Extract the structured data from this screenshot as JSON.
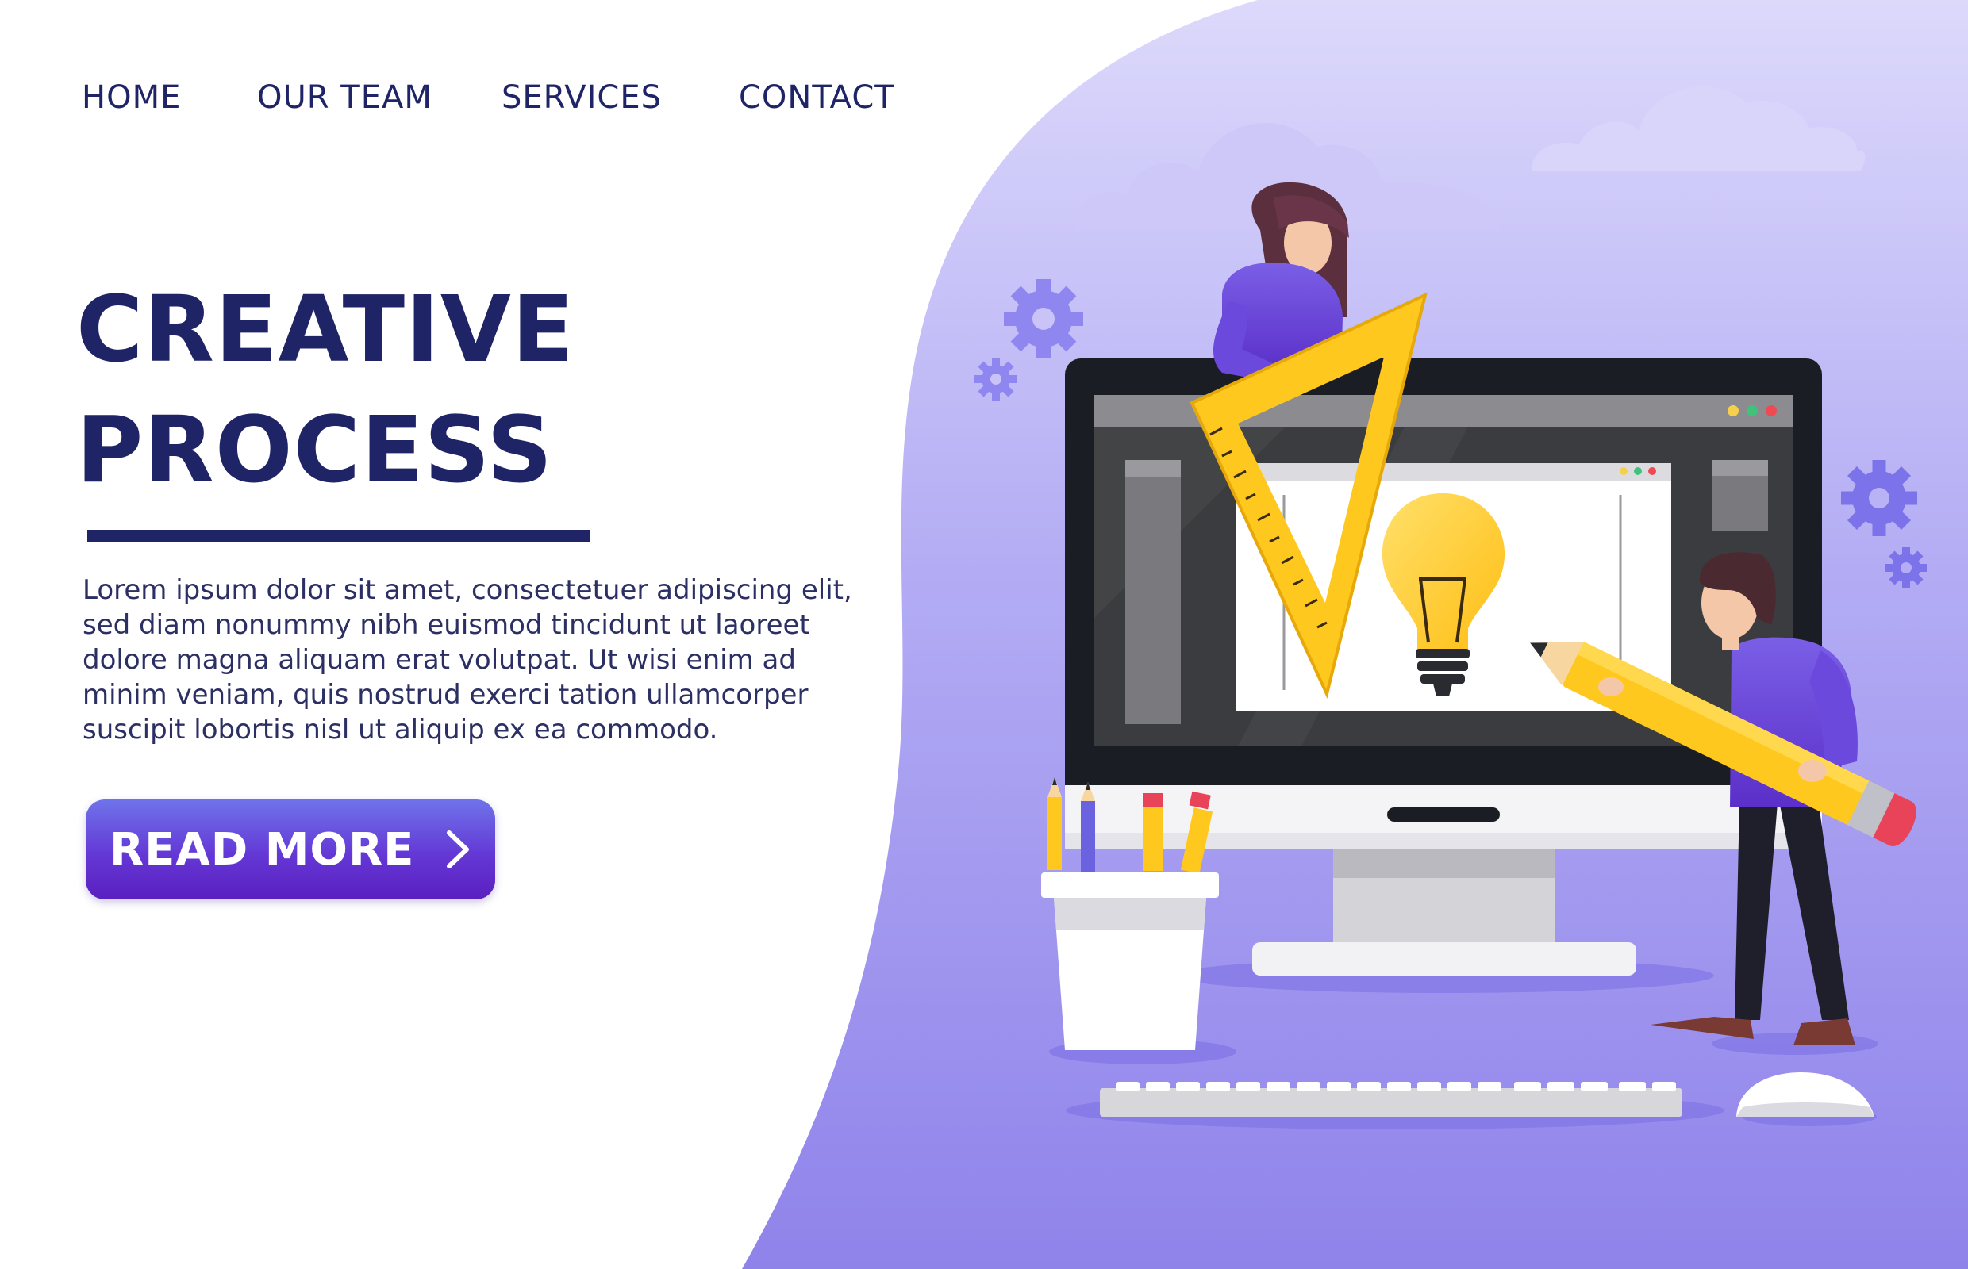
{
  "nav": {
    "items": [
      {
        "label": "HOME"
      },
      {
        "label": "OUR TEAM"
      },
      {
        "label": "SERVICES"
      },
      {
        "label": "CONTACT"
      }
    ]
  },
  "hero": {
    "title_line1": "CREATIVE",
    "title_line2": "PROCESS",
    "body": "Lorem ipsum dolor sit amet, consectetuer adipiscing elit, sed diam nonummy nibh euismod tincidunt ut laoreet dolore magna aliquam erat volutpat. Ut wisi enim ad minim veniam, quis nostrud exerci tation ullamcorper suscipit lobortis nisl ut aliquip ex ea commodo.",
    "cta_label": "READ MORE",
    "cta_icon": "chevron-right-icon"
  },
  "illustration": {
    "icons": [
      "cloud-icon",
      "gear-icon",
      "monitor-icon",
      "lightbulb-icon",
      "set-square-ruler-icon",
      "pencil-icon",
      "pencil-cup-icon",
      "keyboard-icon",
      "mouse-icon",
      "woman-figure",
      "man-figure"
    ]
  },
  "colors": {
    "navy": "#1f2466",
    "accent_purple": "#6438d6",
    "bg_lavender": "#a39af0",
    "yellow": "#ffc81e"
  }
}
